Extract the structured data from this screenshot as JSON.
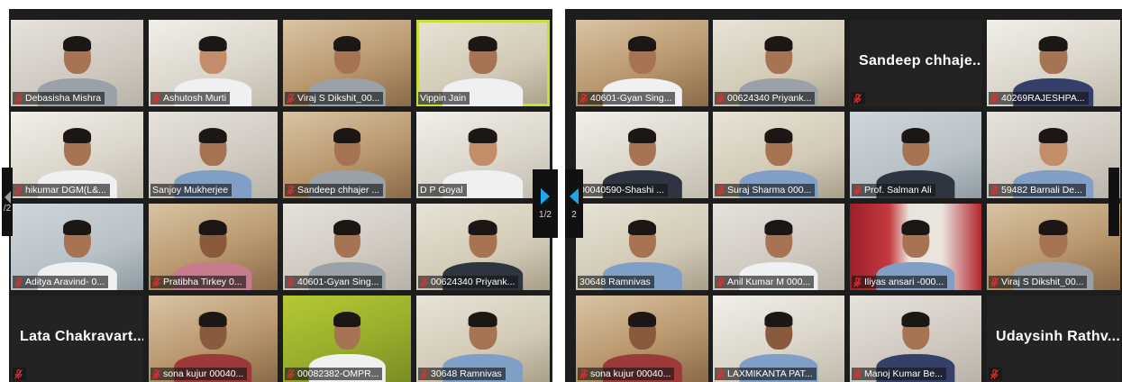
{
  "left_panel": {
    "tiles": [
      {
        "name": "Debasisha Mishra",
        "bg": "bg-wall",
        "look": "shirt-grey",
        "muted": true
      },
      {
        "name": "Ashutosh Murti",
        "bg": "bg-office",
        "look": "shirt-white skin-light",
        "muted": true
      },
      {
        "name": "Viraj S Dikshit_00...",
        "bg": "bg-warm",
        "look": "shirt-grey",
        "muted": true
      },
      {
        "name": "Vippin Jain",
        "bg": "bg-room",
        "look": "shirt-white",
        "muted": false,
        "active": true
      },
      {
        "name": "hikumar DGM(L&...",
        "bg": "bg-office",
        "look": "shirt-white",
        "muted": true
      },
      {
        "name": "Sanjoy Mukherjee",
        "bg": "bg-wall",
        "look": "shirt-blue",
        "muted": false
      },
      {
        "name": "Sandeep chhajer ...",
        "bg": "bg-warm",
        "look": "shirt-grey",
        "muted": true
      },
      {
        "name": "D P Goyal",
        "bg": "bg-office",
        "look": "shirt-white skin-light",
        "muted": false
      },
      {
        "name": "Aditya Aravind- 0...",
        "bg": "bg-shelf",
        "look": "shirt-white",
        "muted": true
      },
      {
        "name": "Pratibha Tirkey 0...",
        "bg": "bg-warm",
        "look": "shirt-pink skin-dark",
        "muted": true
      },
      {
        "name": "40601-Gyan Sing...",
        "bg": "bg-wall",
        "look": "shirt-grey",
        "muted": true
      },
      {
        "name": "00624340 Priyank...",
        "bg": "bg-room",
        "look": "shirt-dark",
        "muted": true
      },
      {
        "name": "",
        "big": "Lata  Chakravart...",
        "bg": "bg-blank",
        "muted": true
      },
      {
        "name": "sona kujur 00040...",
        "bg": "bg-warm",
        "look": "shirt-red skin-dark",
        "muted": true
      },
      {
        "name": "00082382-OMPR...",
        "bg": "bg-green",
        "look": "shirt-white",
        "muted": true
      },
      {
        "name": "30648 Ramnivas",
        "bg": "bg-room",
        "look": "shirt-blue",
        "muted": true
      }
    ]
  },
  "right_panel": {
    "tiles": [
      {
        "name": "40601-Gyan Sing...",
        "bg": "bg-warm",
        "look": "shirt-white",
        "muted": true
      },
      {
        "name": "00624340 Priyank...",
        "bg": "bg-room",
        "look": "shirt-grey",
        "muted": true
      },
      {
        "name": "",
        "big": "Sandeep  chhaje...",
        "bg": "bg-blank",
        "muted": true
      },
      {
        "name": "40269RAJESHPA...",
        "bg": "bg-office",
        "look": "shirt-navy",
        "muted": true
      },
      {
        "name": "00040590-Shashi ...",
        "bg": "bg-office",
        "look": "shirt-dark",
        "muted": false
      },
      {
        "name": "Suraj Sharma 000...",
        "bg": "bg-room",
        "look": "shirt-blue",
        "muted": true
      },
      {
        "name": "Prof. Salman Ali",
        "bg": "bg-shelf",
        "look": "shirt-dark",
        "muted": true
      },
      {
        "name": "59482 Barnali De...",
        "bg": "bg-wall",
        "look": "shirt-blue skin-light",
        "muted": true
      },
      {
        "name": "30648 Ramnivas",
        "bg": "bg-room",
        "look": "shirt-blue",
        "muted": false
      },
      {
        "name": "Anil Kumar M 000...",
        "bg": "bg-wall",
        "look": "shirt-white",
        "muted": true
      },
      {
        "name": "Iliyas ansari -000...",
        "bg": "bg-curtain",
        "look": "shirt-blue",
        "muted": true
      },
      {
        "name": "Viraj S Dikshit_00...",
        "bg": "bg-warm",
        "look": "shirt-grey",
        "muted": true
      },
      {
        "name": "sona kujur 00040...",
        "bg": "bg-warm",
        "look": "shirt-red skin-dark",
        "muted": true
      },
      {
        "name": "LAXMIKANTA PAT...",
        "bg": "bg-office",
        "look": "shirt-blue skin-dark",
        "muted": true
      },
      {
        "name": "Manoj Kumar Be...",
        "bg": "bg-wall",
        "look": "shirt-navy",
        "muted": true
      },
      {
        "name": "",
        "big": "Udaysinh  Rathv...",
        "bg": "bg-blank",
        "muted": true
      }
    ]
  },
  "pager": {
    "left_edge_page": "/2",
    "center_left_page": "1/2",
    "center_right_page": "2"
  },
  "colors": {
    "active_speaker": "#c6e03a",
    "pager_arrow": "#1ea7e8",
    "muted_mic": "#e0302f"
  }
}
